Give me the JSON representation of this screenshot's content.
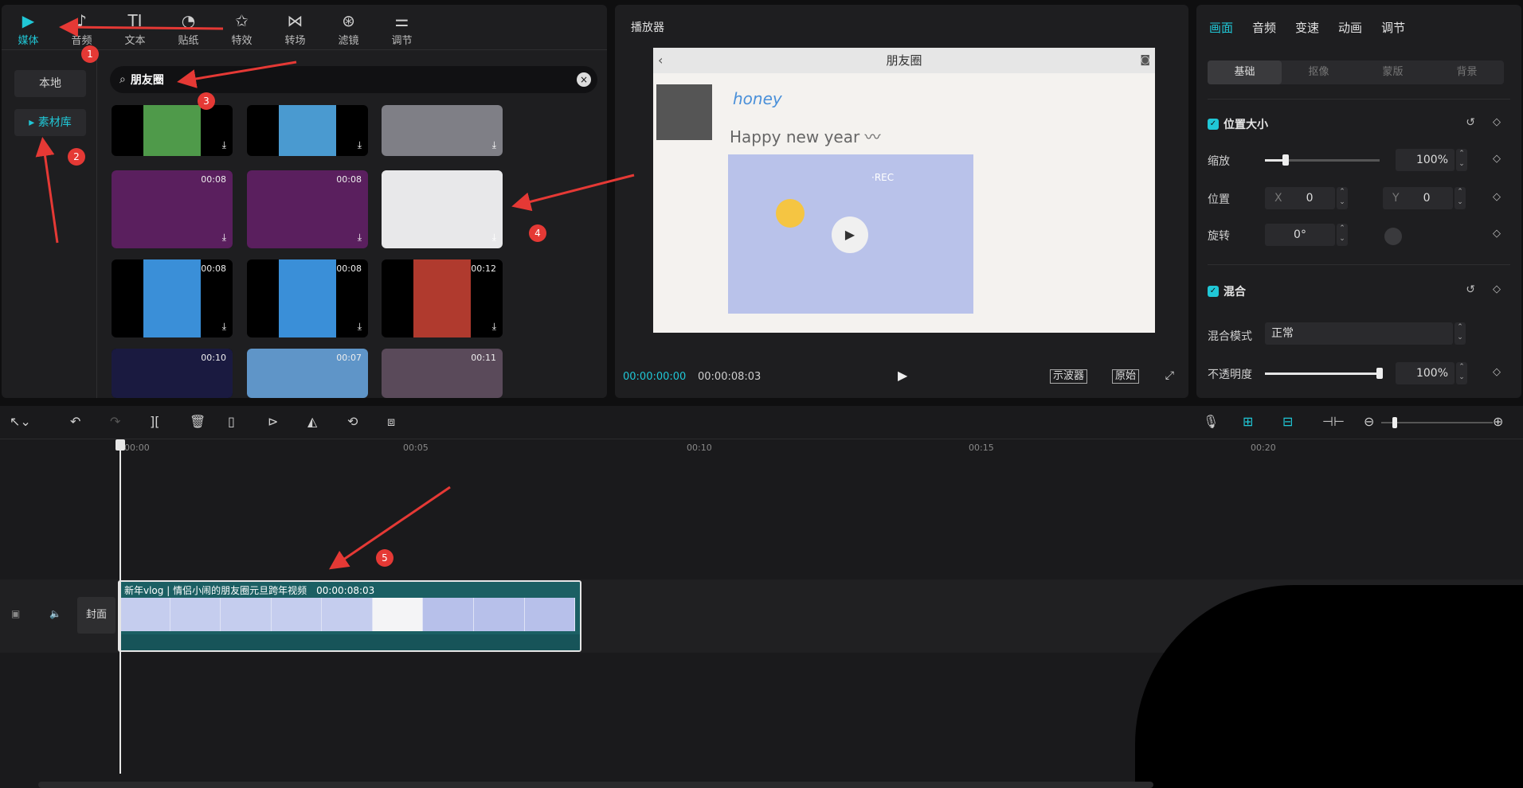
{
  "toolbar": {
    "items": [
      {
        "label": "媒体",
        "icon": "media-icon",
        "glyph": "▶"
      },
      {
        "label": "音频",
        "icon": "audio-icon",
        "glyph": "♪"
      },
      {
        "label": "文本",
        "icon": "text-icon",
        "glyph": "TI"
      },
      {
        "label": "贴纸",
        "icon": "sticker-icon",
        "glyph": "◔"
      },
      {
        "label": "特效",
        "icon": "effects-icon",
        "glyph": "✩"
      },
      {
        "label": "转场",
        "icon": "transition-icon",
        "glyph": "⋈"
      },
      {
        "label": "滤镜",
        "icon": "filter-icon",
        "glyph": "⊛"
      },
      {
        "label": "调节",
        "icon": "adjust-icon",
        "glyph": "⚌"
      }
    ]
  },
  "sidebar": {
    "local": "本地",
    "library": "素材库"
  },
  "search": {
    "value": "朋友圈"
  },
  "thumbnails": [
    {
      "duration": "",
      "color": "#4f9a4a"
    },
    {
      "duration": "",
      "color": "#4a9ad0"
    },
    {
      "duration": "",
      "color": "#7f7f86"
    },
    {
      "duration": "00:08",
      "color": "#5a1f5e"
    },
    {
      "duration": "00:08",
      "color": "#5a1f5e"
    },
    {
      "duration": "",
      "color": "#e8e8ea"
    },
    {
      "duration": "00:08",
      "color": "#3a8fd8"
    },
    {
      "duration": "00:08",
      "color": "#3a8fd8"
    },
    {
      "duration": "00:12",
      "color": "#b03a2e"
    },
    {
      "duration": "00:10",
      "color": "#1a1a40"
    },
    {
      "duration": "00:07",
      "color": "#5f95c8"
    },
    {
      "duration": "00:11",
      "color": "#5a4a5a"
    }
  ],
  "player": {
    "title": "播放器",
    "screen_title": "朋友圈",
    "honey": "honey",
    "greeting": "Happy new year 〰",
    "rec": "·REC",
    "current_time": "00:00:00:00",
    "duration": "00:00:08:03",
    "scope_btn": "示波器",
    "original_btn": "原始"
  },
  "inspector": {
    "tabs": [
      "画面",
      "音频",
      "变速",
      "动画",
      "调节"
    ],
    "subtabs": [
      "基础",
      "抠像",
      "蒙版",
      "背景"
    ],
    "pos_size": "位置大小",
    "scale_label": "缩放",
    "scale_value": "100%",
    "scale_fraction": 0.18,
    "position_label": "位置",
    "x_label": "X",
    "x_value": "0",
    "y_label": "Y",
    "y_value": "0",
    "rotate_label": "旋转",
    "rotate_value": "0°",
    "blend": "混合",
    "blend_mode_label": "混合模式",
    "blend_mode_value": "正常",
    "opacity_label": "不透明度",
    "opacity_value": "100%",
    "opacity_fraction": 1.0
  },
  "timeline": {
    "ticks": [
      "00:00",
      "00:05",
      "00:10",
      "00:15",
      "00:20"
    ],
    "cover": "封面",
    "clip_title": "新年vlog | 情侣小闹的朋友圈元旦跨年视频",
    "clip_duration": "00:00:08:03"
  },
  "markers": [
    "1",
    "2",
    "3",
    "4",
    "5"
  ],
  "colors": {
    "accent": "#20c7d6",
    "annotation": "#e53935"
  }
}
